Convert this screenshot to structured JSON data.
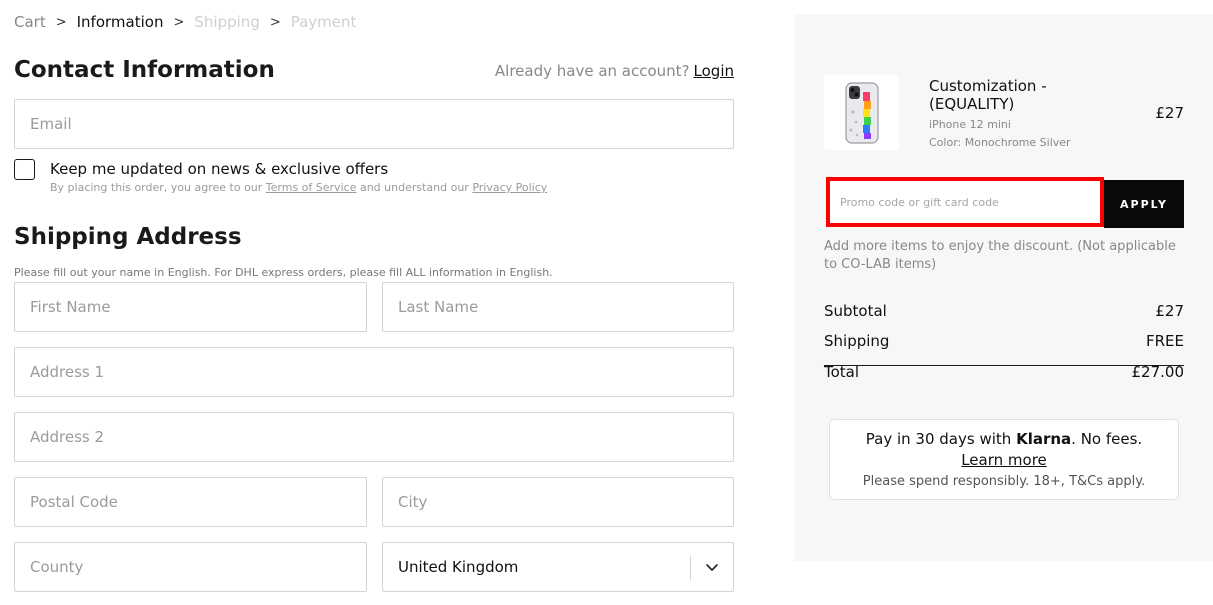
{
  "breadcrumb": {
    "items": [
      "Cart",
      "Information",
      "Shipping",
      "Payment"
    ],
    "separator": ">"
  },
  "contact": {
    "title": "Contact Information",
    "account_prompt": "Already have an account?",
    "login_label": "Login",
    "email_placeholder": "Email",
    "newsletter_label": "Keep me updated on news & exclusive offers",
    "terms_prefix": "By placing this order, you agree to our",
    "terms_link": "Terms of Service",
    "terms_middle": "and understand our",
    "privacy_link": "Privacy Policy"
  },
  "shipping": {
    "title": "Shipping Address",
    "note": "Please fill out your name in English. For DHL express orders, please fill ALL information in English.",
    "first_name_placeholder": "First Name",
    "last_name_placeholder": "Last Name",
    "address1_placeholder": "Address 1",
    "address2_placeholder": "Address 2",
    "postal_placeholder": "Postal Code",
    "city_placeholder": "City",
    "county_placeholder": "County",
    "country_value": "United Kingdom"
  },
  "summary": {
    "product": {
      "name": "Customization - (EQUALITY)",
      "variant": "iPhone 12 mini",
      "color": "Color: Monochrome Silver",
      "price": "£27"
    },
    "promo_placeholder": "Promo code or gift card code",
    "apply_label": "APPLY",
    "discount_note": "Add more items to enjoy the discount. (Not applicable to CO-LAB items)",
    "subtotal_label": "Subtotal",
    "subtotal_value": "£27",
    "shipping_label": "Shipping",
    "shipping_value": "FREE",
    "total_label": "Total",
    "total_value": "£27.00"
  },
  "klarna": {
    "line1_prefix": "Pay in 30 days with",
    "brand": "Klarna",
    "line1_suffix": ". No fees.",
    "learn_more": "Learn more",
    "disclaimer": "Please spend responsibly. 18+, T&Cs apply."
  },
  "colors": {
    "panel_bg": "#f7f7f7",
    "highlight": "#ff0000",
    "button_bg": "#0a0a0a"
  }
}
